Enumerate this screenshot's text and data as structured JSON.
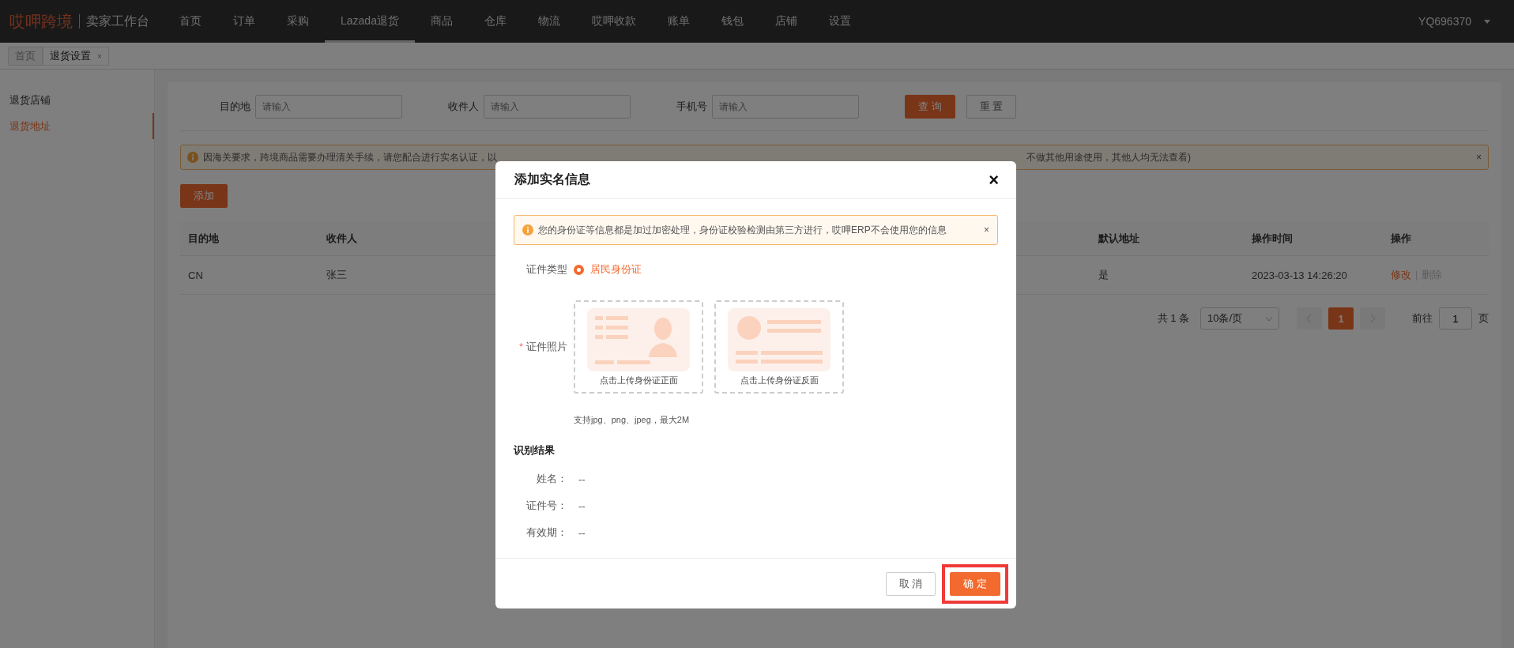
{
  "nav": {
    "brand": "哎呷跨境",
    "subtitle": "卖家工作台",
    "user": "YQ696370",
    "items": [
      {
        "label": "首页",
        "selected": false
      },
      {
        "label": "订单",
        "selected": false
      },
      {
        "label": "采购",
        "selected": false
      },
      {
        "label": "Lazada退货",
        "selected": true
      },
      {
        "label": "商品",
        "selected": false
      },
      {
        "label": "仓库",
        "selected": false
      },
      {
        "label": "物流",
        "selected": false
      },
      {
        "label": "哎呷收款",
        "selected": false
      },
      {
        "label": "账单",
        "selected": false
      },
      {
        "label": "钱包",
        "selected": false
      },
      {
        "label": "店铺",
        "selected": false
      },
      {
        "label": "设置",
        "selected": false
      }
    ]
  },
  "tabs": [
    {
      "label": "首页",
      "selected": false
    },
    {
      "label": "退货设置",
      "selected": true,
      "close": "×"
    }
  ],
  "sidebar": {
    "items": [
      {
        "label": "退货店铺",
        "selected": false
      },
      {
        "label": "退货地址",
        "selected": true
      }
    ]
  },
  "filters": [
    {
      "label": "目的地",
      "placeholder": "请输入"
    },
    {
      "label": "收件人",
      "placeholder": "请输入"
    },
    {
      "label": "手机号",
      "placeholder": "请输入"
    }
  ],
  "filter_buttons": [
    {
      "label": "查 询",
      "kind": "primary"
    },
    {
      "label": "重 置",
      "kind": "default"
    }
  ],
  "notice": {
    "text_before": "因海关要求，跨境商品需要办理清关手续，请您配合进行实名认证，以",
    "text_after": "不做其他用途使用，其他人均无法查看)",
    "close": "×"
  },
  "add_button": "添加",
  "table": {
    "columns": [
      "目的地",
      "收件人",
      "默认地址",
      "操作时间",
      "操作"
    ],
    "rows": [
      {
        "cells": [
          "CN",
          "张三",
          "是",
          "2023-03-13 14:26:20"
        ],
        "actions": [
          {
            "label": "修改",
            "disabled": false
          },
          {
            "label": "删除",
            "disabled": true
          }
        ]
      }
    ]
  },
  "pagination": {
    "total": "共 1 条",
    "page_size": "10条/页",
    "pages": [
      {
        "label": "1",
        "selected": true
      }
    ],
    "goto_label": "前往",
    "goto_value": "1",
    "goto_suffix": "页"
  },
  "modal": {
    "title": "添加实名信息",
    "close": "×",
    "alert": {
      "text": "您的身份证等信息都是加过加密处理，身份证校验检测由第三方进行，哎呷ERP不会使用您的信息",
      "close": "×"
    },
    "cert_type": {
      "label": "证件类型",
      "options": [
        {
          "label": "居民身份证",
          "selected": true
        }
      ]
    },
    "photo": {
      "label": "证件照片",
      "required_mark": "*",
      "uploads": [
        {
          "kind": "front",
          "label": "点击上传身份证正面"
        },
        {
          "kind": "back",
          "label": "点击上传身份证反面"
        }
      ],
      "hint": "支持jpg、png、jpeg，最大2M"
    },
    "result": {
      "title": "识别结果",
      "fields": [
        {
          "label": "姓名：",
          "value": "--"
        },
        {
          "label": "证件号：",
          "value": "--"
        },
        {
          "label": "有效期：",
          "value": "--"
        }
      ]
    },
    "buttons": [
      {
        "label": "取 消",
        "kind": "default",
        "highlighted": false
      },
      {
        "label": "确 定",
        "kind": "primary",
        "highlighted": true
      }
    ]
  }
}
